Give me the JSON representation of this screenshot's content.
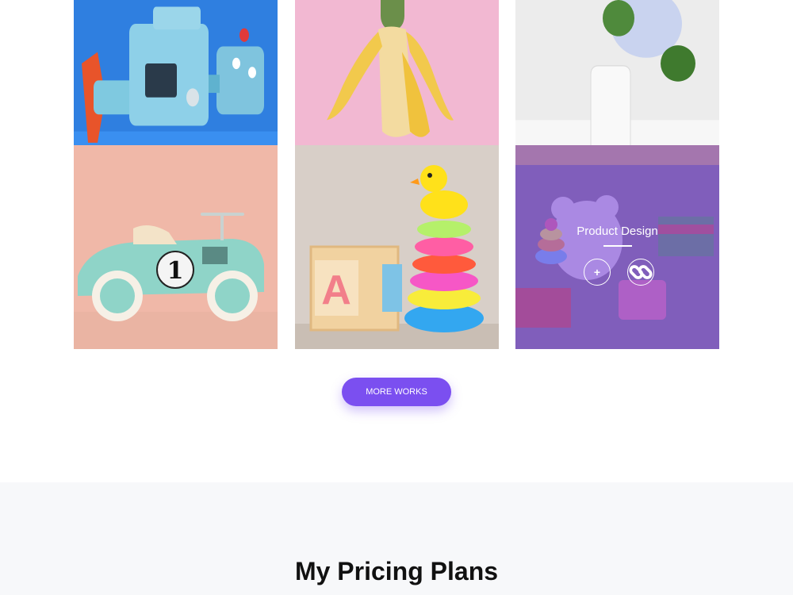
{
  "portfolio": {
    "items": [
      {
        "subject": "tin robot toy on blue background"
      },
      {
        "subject": "peeled banana cactus on pink background"
      },
      {
        "subject": "hydrangea in white vase"
      },
      {
        "subject": "mint toy race car number 1"
      },
      {
        "subject": "stacking ring toy with rubber duck and letter blocks"
      },
      {
        "subject": "pile of toys with teddy bear",
        "hover_title": "Product Design",
        "hover_icons": [
          "plus-icon",
          "link-icon"
        ]
      }
    ],
    "number_on_car": "1",
    "block_letter": "A",
    "more_button_label": "MORE WORKS"
  },
  "pricing": {
    "heading": "My Pricing Plans"
  },
  "colors": {
    "accent": "#7b4ff0",
    "overlay": "#8554e6",
    "section_bg": "#f7f8fa"
  }
}
